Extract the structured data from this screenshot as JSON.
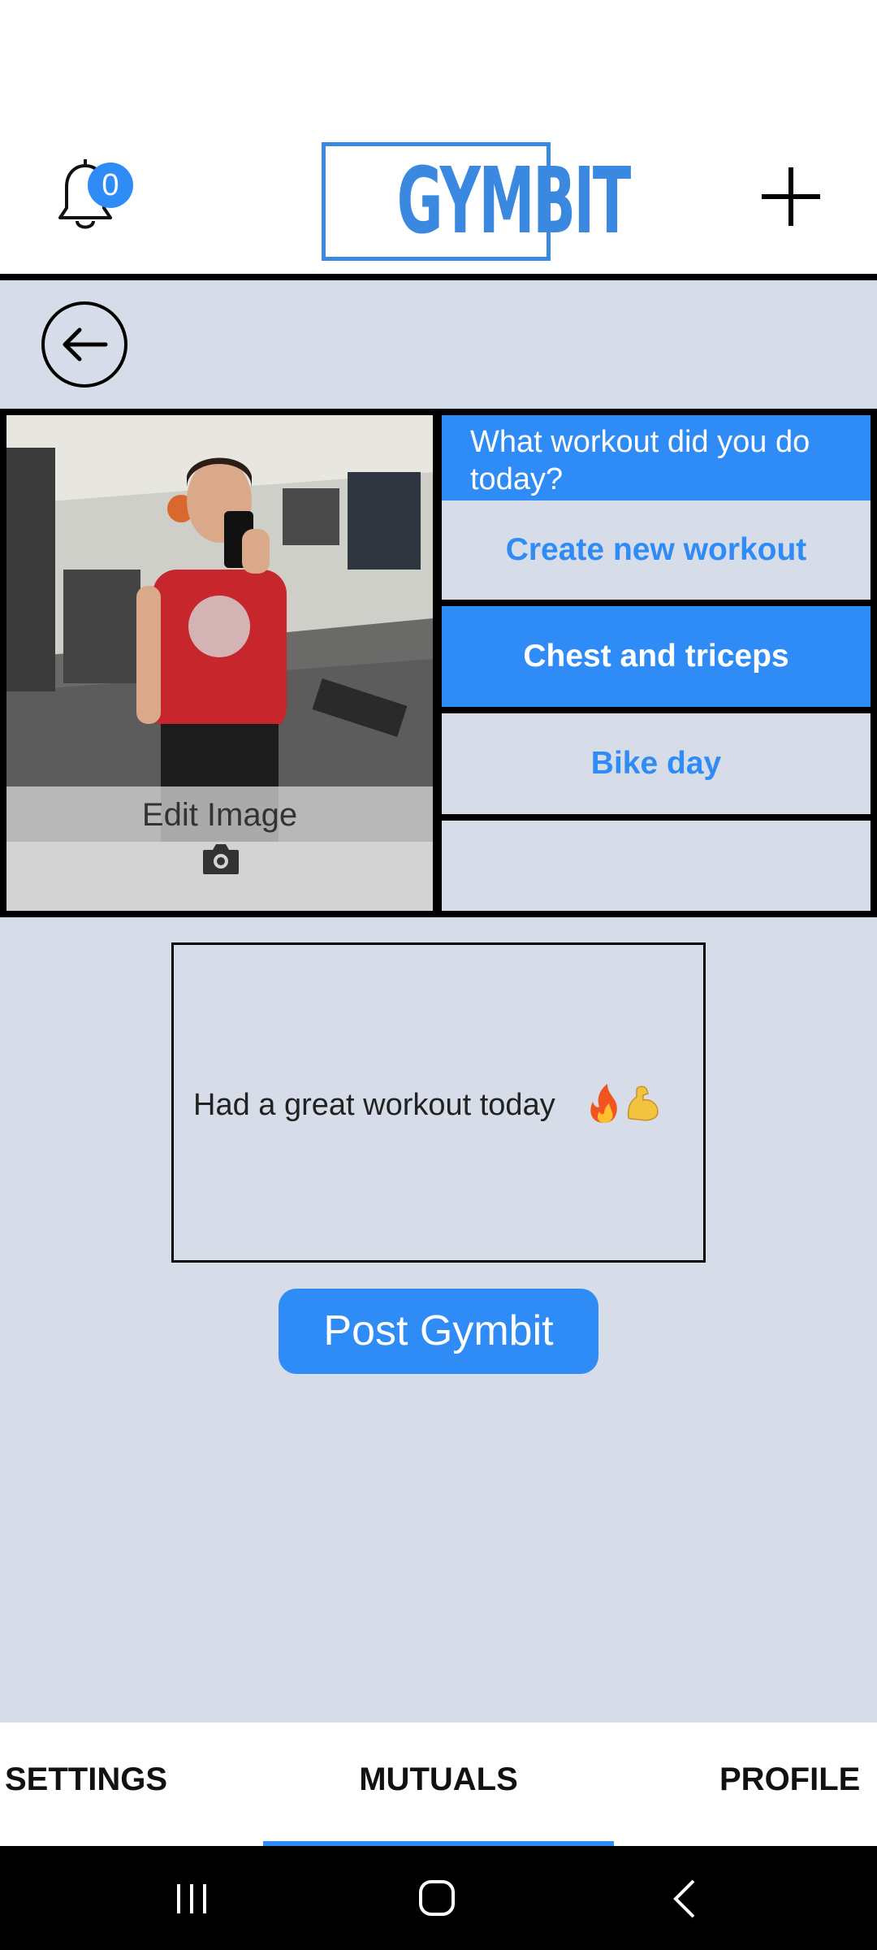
{
  "header": {
    "notification_count": "0",
    "logo_text": "GYMBIT",
    "icons": {
      "bell": "bell-icon",
      "add": "plus-icon"
    }
  },
  "toolbar": {
    "back_icon": "arrow-left-icon"
  },
  "photo": {
    "edit_label": "Edit Image",
    "camera_icon": "camera-icon"
  },
  "workout": {
    "question": "What workout did you do today?",
    "options": [
      {
        "label": "Create new workout",
        "selected": false
      },
      {
        "label": "Chest and triceps",
        "selected": true
      },
      {
        "label": "Bike day",
        "selected": false
      },
      {
        "label": "",
        "selected": false
      }
    ]
  },
  "caption": {
    "text": "Had a great workout today",
    "emoji": [
      "fire",
      "flexed-biceps"
    ]
  },
  "post_button": {
    "label": "Post Gymbit"
  },
  "tabs": {
    "items": [
      {
        "label": "SETTINGS"
      },
      {
        "label": "MUTUALS",
        "active": true
      },
      {
        "label": "PROFILE"
      }
    ]
  },
  "colors": {
    "accent": "#2f8bf5",
    "logo": "#3a88e0",
    "background": "#d6dde8"
  }
}
